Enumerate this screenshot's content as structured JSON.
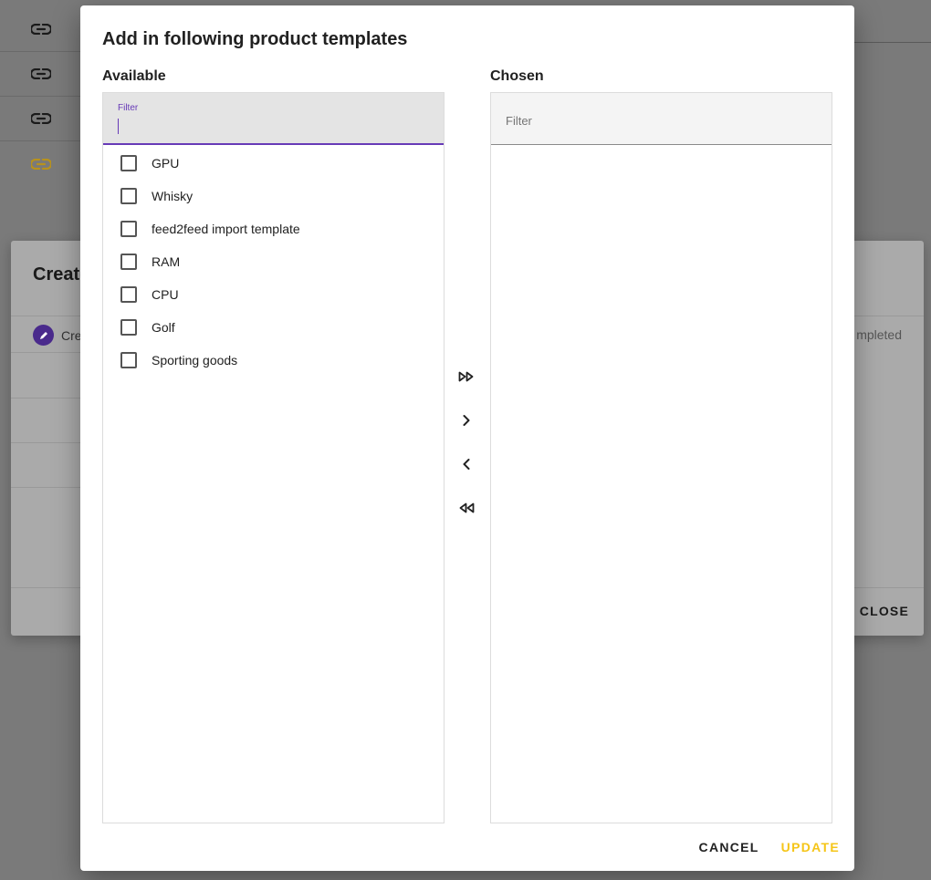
{
  "background": {
    "link_rows": [
      {
        "icon": "link-icon",
        "color": "#1a1a1a"
      },
      {
        "icon": "link-icon",
        "color": "#1a1a1a"
      },
      {
        "icon": "link-icon",
        "color": "#1a1a1a"
      },
      {
        "icon": "link-icon",
        "color": "#b8921c"
      }
    ],
    "dialog": {
      "title": "Create",
      "step_label": "Cre",
      "status_text": "mpleted",
      "close_label": "CLOSE"
    }
  },
  "modal": {
    "title": "Add in following product templates",
    "available": {
      "label": "Available",
      "filter_label": "Filter",
      "filter_value": "",
      "items": [
        "GPU",
        "Whisky",
        "feed2feed import template",
        "RAM",
        "CPU",
        "Golf",
        "Sporting goods"
      ]
    },
    "chosen": {
      "label": "Chosen",
      "filter_placeholder": "Filter",
      "items": []
    },
    "transfer": {
      "move_all_right": "double-chevron-right-icon",
      "move_right": "chevron-right-icon",
      "move_left": "chevron-left-icon",
      "move_all_left": "double-chevron-left-icon"
    },
    "actions": {
      "cancel_label": "CANCEL",
      "update_label": "UPDATE"
    },
    "colors": {
      "accent": "#673ab7",
      "update": "#f5c518"
    }
  }
}
